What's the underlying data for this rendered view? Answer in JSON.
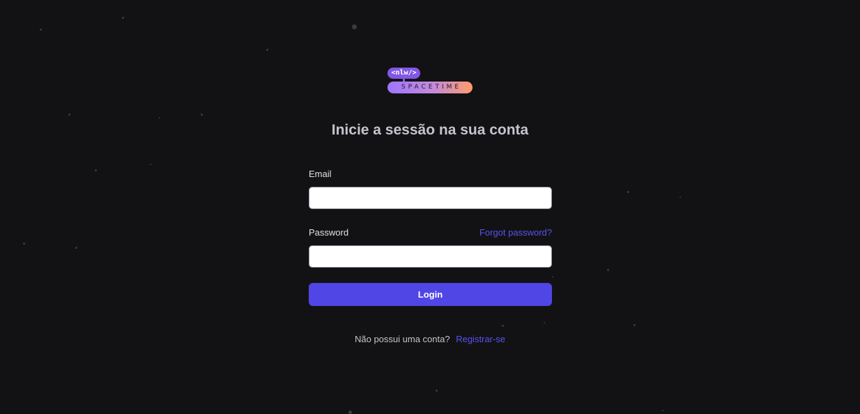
{
  "logo": {
    "top_text": "<nlw/>",
    "bottom_text": "SPACETIME"
  },
  "page_title": "Inicie a sessão na sua conta",
  "form": {
    "email_label": "Email",
    "email_value": "",
    "password_label": "Password",
    "password_value": "",
    "forgot_password_label": "Forgot password?",
    "login_label": "Login"
  },
  "signup": {
    "prompt": "Não possui uma conta?",
    "link_label": "Registrar-se"
  },
  "colors": {
    "background": "#121214",
    "accent": "#4f46e5",
    "link": "#5a52f0",
    "brand_purple": "#8257e5",
    "brand_orange": "#ff9b6a"
  }
}
